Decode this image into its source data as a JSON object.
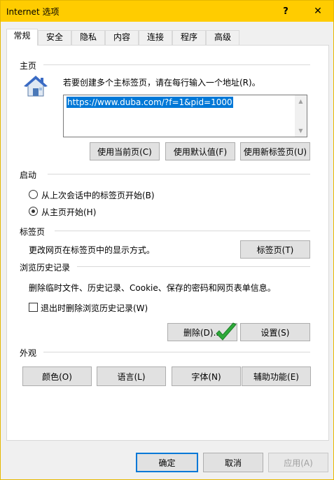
{
  "window": {
    "title": "Internet 选项",
    "help_glyph": "?",
    "close_glyph": "✕"
  },
  "tabs": [
    {
      "label": "常规",
      "active": true
    },
    {
      "label": "安全"
    },
    {
      "label": "隐私"
    },
    {
      "label": "内容"
    },
    {
      "label": "连接"
    },
    {
      "label": "程序"
    },
    {
      "label": "高级"
    }
  ],
  "homepage": {
    "title": "主页",
    "description": "若要创建多个主标签页，请在每行输入一个地址(R)。",
    "url": "https://www.duba.com/?f=1&pid=1000",
    "use_current": "使用当前页(C)",
    "use_default": "使用默认值(F)",
    "use_new_tab": "使用新标签页(U)"
  },
  "startup": {
    "title": "启动",
    "option_last_session": "从上次会话中的标签页开始(B)",
    "option_homepage": "从主页开始(H)",
    "selected": "homepage"
  },
  "tabs_section": {
    "title": "标签页",
    "description": "更改网页在标签页中的显示方式。",
    "button": "标签页(T)"
  },
  "history": {
    "title": "浏览历史记录",
    "description": "删除临时文件、历史记录、Cookie、保存的密码和网页表单信息。",
    "checkbox_label": "退出时删除浏览历史记录(W)",
    "checkbox_checked": false,
    "delete_button": "删除(D)...",
    "settings_button": "设置(S)"
  },
  "appearance": {
    "title": "外观",
    "colors": "颜色(O)",
    "languages": "语言(L)",
    "fonts": "字体(N)",
    "accessibility": "辅助功能(E)"
  },
  "footer": {
    "ok": "确定",
    "cancel": "取消",
    "apply": "应用(A)"
  },
  "colors": {
    "titlebar": "#ffcc00",
    "accent": "#0078d7",
    "check": "#2eaa3a"
  }
}
